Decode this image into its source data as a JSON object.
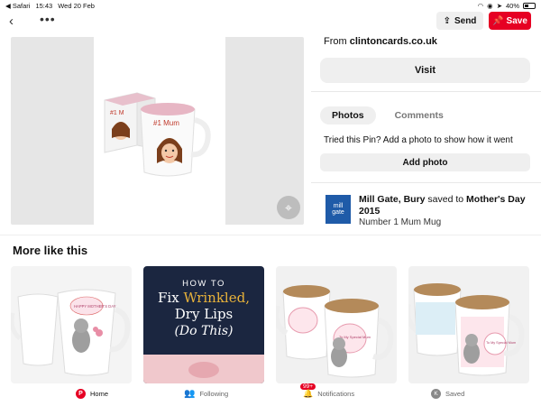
{
  "status_bar": {
    "app": "◀ Safari",
    "time": "15:43",
    "date": "Wed 20 Feb",
    "battery": "40%"
  },
  "topbar": {
    "send_label": "Send",
    "save_label": "Save"
  },
  "pin": {
    "mug_text": "#1 Mum",
    "box_text": "#1 M"
  },
  "detail": {
    "from_prefix": "From ",
    "from_site": "clintoncards.co.uk",
    "visit_label": "Visit",
    "tabs": [
      {
        "label": "Photos",
        "active": true
      },
      {
        "label": "Comments",
        "active": false
      }
    ],
    "tried_text": "Tried this Pin? Add a photo to show how it went",
    "add_photo_label": "Add photo",
    "saver": {
      "logo_line1": "mill",
      "logo_line2": "gate",
      "name": "Mill Gate, Bury",
      "saved_to": " saved to ",
      "board": "Mother's Day 2015",
      "pin_title": "Number 1 Mum Mug"
    }
  },
  "more_like": {
    "heading": "More like this",
    "cards": [
      {
        "type": "mug",
        "mug_text": "HAPPY MOTHER'S DAY"
      },
      {
        "type": "article",
        "howto": "HOW TO",
        "line_fix": "Fix ",
        "line_wrinkled": "Wrinkled,",
        "line2": "Dry Lips",
        "line3": "(Do This)"
      },
      {
        "type": "mug",
        "mug_text": "To My Special Mum"
      },
      {
        "type": "mug",
        "mug_text": "To My Special Mum"
      }
    ]
  },
  "bottom_nav": {
    "home": "Home",
    "following": "Following",
    "notifications": "Notifications",
    "notifications_badge": "99+",
    "saved": "Saved",
    "saved_initial": "K"
  },
  "colors": {
    "brand": "#e60023",
    "saver_logo": "#1f5ba8",
    "article_bg": "#1b2640",
    "article_accent": "#e8b23a"
  }
}
